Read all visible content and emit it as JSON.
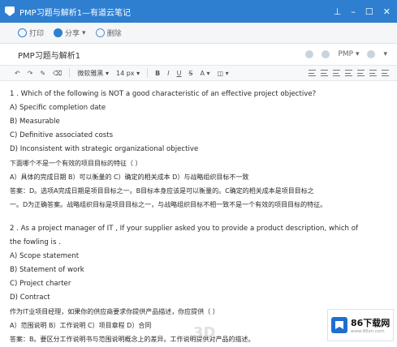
{
  "window": {
    "title": "PMP习题与解析1—有道云笔记"
  },
  "toolbar": {
    "print": "打印",
    "share": "分享",
    "delete": "删除"
  },
  "note": {
    "title": "PMP习题与解析1",
    "tag_label": "PMP"
  },
  "format": {
    "font_family": "微软雅黑",
    "font_size": "14 px",
    "bold": "B",
    "italic": "I",
    "underline": "U",
    "color": "A"
  },
  "content": {
    "q1": {
      "question": "1 . Which of the following is NOT a good characteristic of an effective project objective?",
      "a": "A) Specific completion date",
      "b": "B) Measurable",
      "c": "C) Definitive associated costs",
      "d": "D) Inconsistent with strategic organizational objective",
      "cn_question": "下面哪个不是一个有效的项目目标的特征（  ）",
      "cn_options": "A）具体的完成日期 B）可以衡量的 C）确定的相关成本 D）与战略组织目标不一致",
      "answer_line1": "答案：D。选项A完成日期是项目目标之一。B目标本身应该是可以衡量的。C确定的相关成本是项目目标之",
      "answer_line2": "一。D为正确答案。战略组织目标是项目目标之一，与战略组织目标不相一致不是一个有效的项目目标的特征。"
    },
    "q2": {
      "question_line1": "2 . As a project manager of IT , If your supplier asked you to provide a product description, which of",
      "question_line2": "the fowling is    .",
      "a": "A) Scope statement",
      "b": "B) Statement of work",
      "c": "C) Project charter",
      "d": "D) Contract",
      "cn_question": "作为IT业项目经理，如果你的供应商要求你提供产品描述，你应提供（  ）",
      "cn_options": "A）范围说明 B）工作说明 C）项目章程 D）合同",
      "answer_line1": "答案：B。要区分工作说明书与范围说明概念上的差异。工作说明提供对产品的描述。"
    }
  },
  "watermark": {
    "brand": "86下载网",
    "url": "www.86zn.com",
    "overlay": "3D"
  }
}
